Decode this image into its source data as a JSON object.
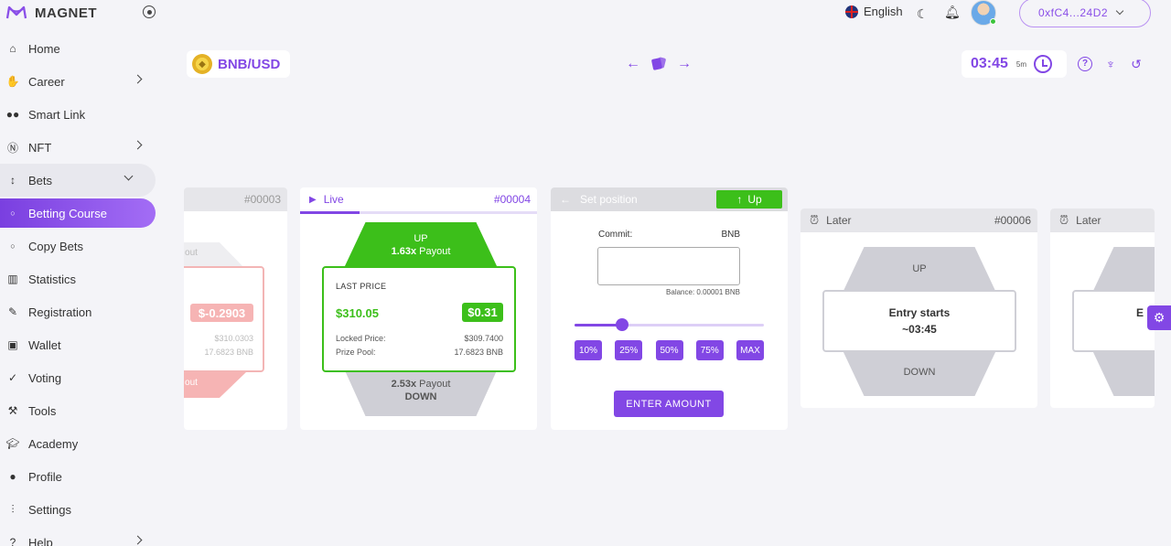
{
  "brand": {
    "name": "MAGNET"
  },
  "sidebar": {
    "items": [
      {
        "label": "Home"
      },
      {
        "label": "Career"
      },
      {
        "label": "Smart Link"
      },
      {
        "label": "NFT"
      },
      {
        "label": "Bets"
      },
      {
        "label": "Betting Course"
      },
      {
        "label": "Copy Bets"
      },
      {
        "label": "Statistics"
      },
      {
        "label": "Registration"
      },
      {
        "label": "Wallet"
      },
      {
        "label": "Voting"
      },
      {
        "label": "Tools"
      },
      {
        "label": "Academy"
      },
      {
        "label": "Profile"
      },
      {
        "label": "Settings"
      },
      {
        "label": "Help"
      }
    ]
  },
  "topbar": {
    "language": "English",
    "wallet": "0xfC4...24D2"
  },
  "pair": {
    "label": "BNB/USD"
  },
  "timer": {
    "value": "03:45",
    "interval": "5m"
  },
  "cards": {
    "expired": {
      "round": "#00003",
      "payout_up": "out",
      "payout_down": "out",
      "price": "$-0.2903",
      "locked": "$310.0303",
      "pool": "17.6823 BNB"
    },
    "live": {
      "status": "Live",
      "round": "#00004",
      "up_label": "UP",
      "up_payout": "1.63x",
      "payout_word": "Payout",
      "last_price_label": "LAST PRICE",
      "last_price": "$310.05",
      "change": "$0.31",
      "locked_label": "Locked Price:",
      "locked_value": "$309.7400",
      "pool_label": "Prize Pool:",
      "pool_value": "17.6823 BNB",
      "down_payout": "2.53x",
      "down_label": "DOWN",
      "progress": 0.25
    },
    "set_position": {
      "title": "Set position",
      "direction": "Up",
      "commit_label": "Commit:",
      "currency": "BNB",
      "amount_value": "",
      "balance": "Balance: 0.00001 BNB",
      "slider": 0.25,
      "percents": [
        "10%",
        "25%",
        "50%",
        "75%",
        "MAX"
      ],
      "enter_label": "ENTER AMOUNT"
    },
    "later": {
      "status": "Later",
      "round": "#00006",
      "up_label": "UP",
      "entry": "Entry starts",
      "entry_time": "~03:45",
      "down_label": "DOWN"
    },
    "later2": {
      "status": "Later",
      "entry_partial": "E"
    }
  },
  "colors": {
    "accent": "#8247e5",
    "green": "#3cbf1a",
    "red": "#f3a5a5"
  }
}
